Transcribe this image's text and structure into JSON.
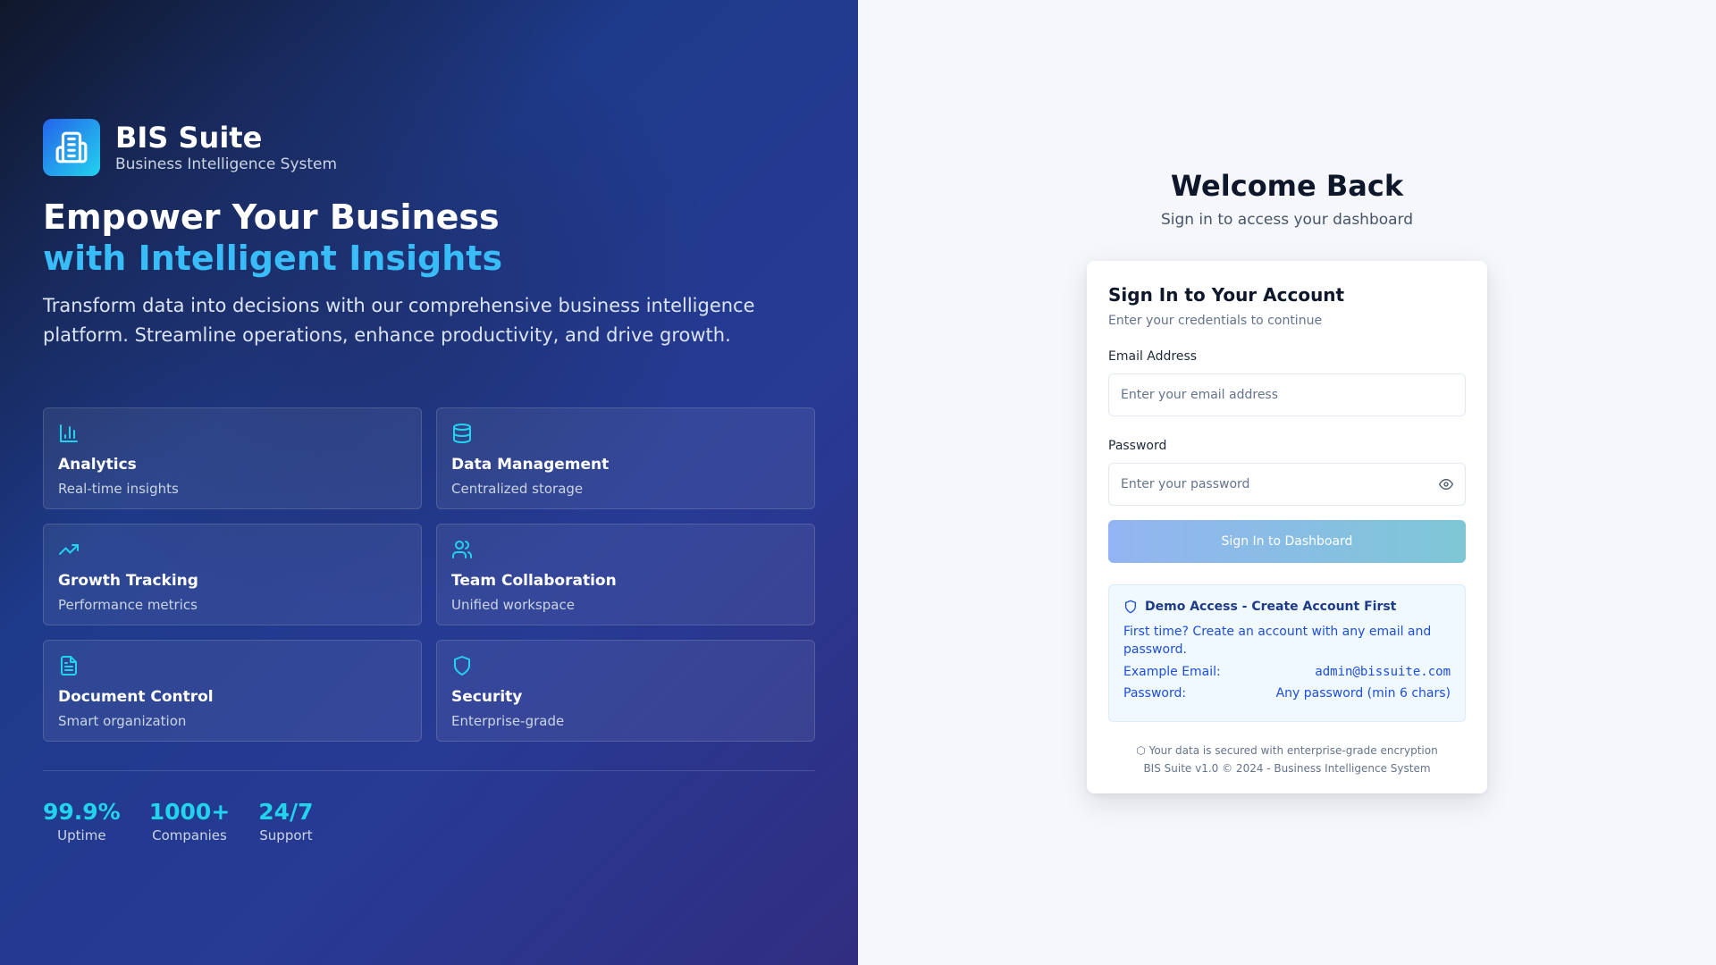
{
  "brand": {
    "name": "BIS Suite",
    "subtitle": "Business Intelligence System",
    "logo_icon": "building-icon",
    "gradient": [
      "#2563eb",
      "#22d3ee"
    ]
  },
  "hero": {
    "line1": "Empower Your Business",
    "line2": "with Intelligent Insights",
    "description": "Transform data into decisions with our comprehensive business intelligence platform. Streamline operations, enhance productivity, and drive growth."
  },
  "features": [
    {
      "icon": "bar-chart-icon",
      "title": "Analytics",
      "subtitle": "Real-time insights"
    },
    {
      "icon": "database-icon",
      "title": "Data Management",
      "subtitle": "Centralized storage"
    },
    {
      "icon": "trending-up-icon",
      "title": "Growth Tracking",
      "subtitle": "Performance metrics"
    },
    {
      "icon": "users-icon",
      "title": "Team Collaboration",
      "subtitle": "Unified workspace"
    },
    {
      "icon": "document-icon",
      "title": "Document Control",
      "subtitle": "Smart organization"
    },
    {
      "icon": "shield-icon",
      "title": "Security",
      "subtitle": "Enterprise-grade"
    }
  ],
  "stats": [
    {
      "value": "99.9%",
      "label": "Uptime"
    },
    {
      "value": "1000+",
      "label": "Companies"
    },
    {
      "value": "24/7",
      "label": "Support"
    }
  ],
  "welcome": {
    "title": "Welcome Back",
    "subtitle": "Sign in to access your dashboard"
  },
  "form": {
    "title": "Sign In to Your Account",
    "subtitle": "Enter your credentials to continue",
    "email_label": "Email Address",
    "email_placeholder": "Enter your email address",
    "email_value": "",
    "password_label": "Password",
    "password_placeholder": "Enter your password",
    "password_value": "",
    "submit_label": "Sign In to Dashboard"
  },
  "demo": {
    "title": "Demo Access - Create Account First",
    "text": "First time? Create an account with any email and password.",
    "email_label": "Example Email:",
    "email_value": "admin@bissuite.com",
    "password_label": "Password:",
    "password_value": "Any password (min 6 chars)"
  },
  "footer": {
    "security_note": "⬡ Your data is secured with enterprise-grade encryption",
    "version": "BIS Suite v1.0 © 2024 - Business Intelligence System"
  },
  "colors": {
    "accent": "#22d3ee",
    "hero_accent": "#38bdf8",
    "panel_bg": "#f5f7fb"
  }
}
